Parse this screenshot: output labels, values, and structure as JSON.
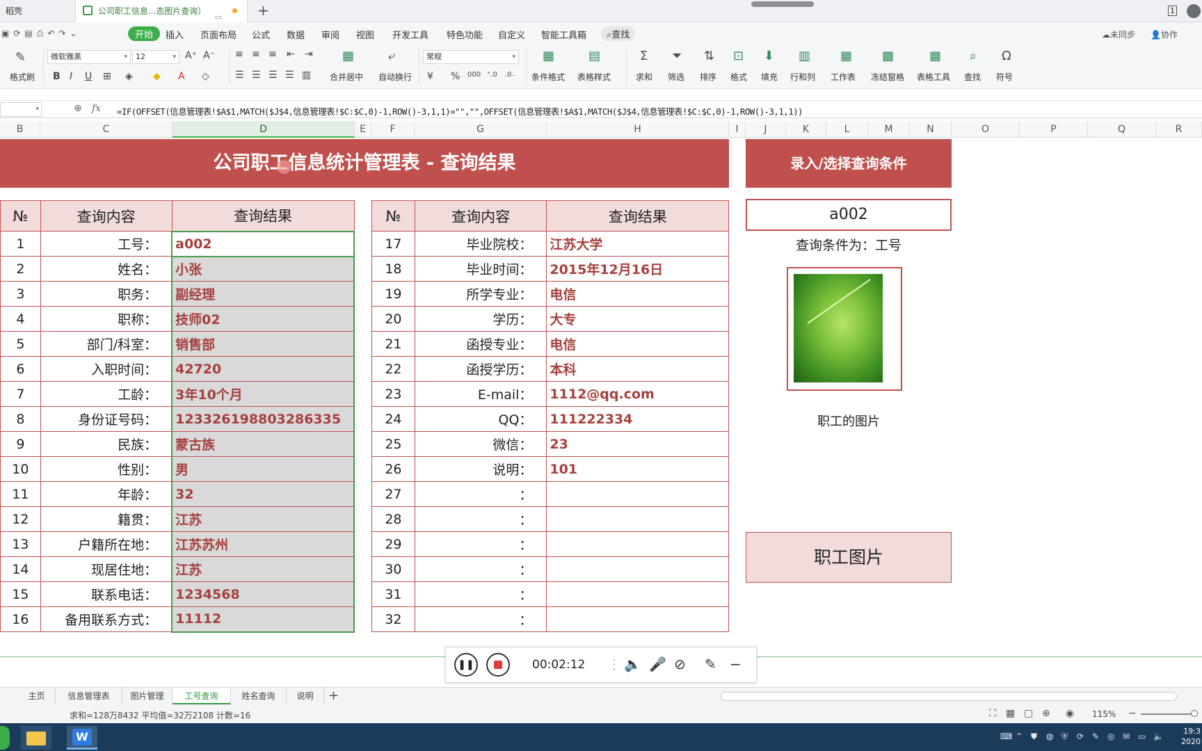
{
  "window": {
    "tabs": [
      {
        "label": "稻壳"
      },
      {
        "label": "公司职工信息...态图片查询）"
      }
    ],
    "win_badge": "1"
  },
  "menu": {
    "items": [
      "开始",
      "插入",
      "页面布局",
      "公式",
      "数据",
      "审阅",
      "视图",
      "开发工具",
      "特色功能",
      "自定义",
      "智能工具箱"
    ],
    "find": "查找",
    "sync": "未同步",
    "collab": "协作"
  },
  "ribbon": {
    "format_painter": "格式刷",
    "font_name": "微软雅黑",
    "font_size": "12",
    "merge_center": "合并居中",
    "wrap_text": "自动换行",
    "number_format": "常规",
    "buttons": [
      "条件格式",
      "表格样式",
      "求和",
      "筛选",
      "排序",
      "格式",
      "填充",
      "行和列",
      "工作表",
      "冻结窗格",
      "表格工具",
      "查找",
      "符号"
    ]
  },
  "formula_bar": {
    "formula": "=IF(OFFSET(信息管理表!$A$1,MATCH($J$4,信息管理表!$C:$C,0)-1,ROW()-3,1,1)=\"\",\"\",OFFSET(信息管理表!$A$1,MATCH($J$4,信息管理表!$C:$C,0)-1,ROW()-3,1,1))"
  },
  "columns": [
    "B",
    "C",
    "D",
    "E",
    "F",
    "G",
    "H",
    "I",
    "J",
    "K",
    "L",
    "M",
    "N",
    "O",
    "P",
    "Q",
    "R"
  ],
  "sheet": {
    "main_title": "公司职工信息统计管理表 - 查询结果",
    "query_title": "录入/选择查询条件",
    "headers": {
      "no": "№",
      "content": "查询内容",
      "result": "查询结果"
    },
    "left_rows": [
      {
        "no": "1",
        "label": "工号：",
        "value": "a002"
      },
      {
        "no": "2",
        "label": "姓名：",
        "value": "小张"
      },
      {
        "no": "3",
        "label": "职务：",
        "value": "副经理"
      },
      {
        "no": "4",
        "label": "职称：",
        "value": "技师02"
      },
      {
        "no": "5",
        "label": "部门/科室：",
        "value": "销售部"
      },
      {
        "no": "6",
        "label": "入职时间：",
        "value": "42720"
      },
      {
        "no": "7",
        "label": "工龄：",
        "value": "3年10个月"
      },
      {
        "no": "8",
        "label": "身份证号码：",
        "value": "123326198803286335"
      },
      {
        "no": "9",
        "label": "民族：",
        "value": "蒙古族"
      },
      {
        "no": "10",
        "label": "性别：",
        "value": "男"
      },
      {
        "no": "11",
        "label": "年龄：",
        "value": "32"
      },
      {
        "no": "12",
        "label": "籍贯：",
        "value": "江苏"
      },
      {
        "no": "13",
        "label": "户籍所在地：",
        "value": "江苏苏州"
      },
      {
        "no": "14",
        "label": "现居住地：",
        "value": "江苏"
      },
      {
        "no": "15",
        "label": "联系电话：",
        "value": "1234568"
      },
      {
        "no": "16",
        "label": "备用联系方式：",
        "value": "11112"
      }
    ],
    "right_rows": [
      {
        "no": "17",
        "label": "毕业院校：",
        "value": "江苏大学"
      },
      {
        "no": "18",
        "label": "毕业时间：",
        "value": "2015年12月16日"
      },
      {
        "no": "19",
        "label": "所学专业：",
        "value": "电信"
      },
      {
        "no": "20",
        "label": "学历：",
        "value": "大专"
      },
      {
        "no": "21",
        "label": "函授专业：",
        "value": "电信"
      },
      {
        "no": "22",
        "label": "函授学历：",
        "value": "本科"
      },
      {
        "no": "23",
        "label": "E-mail：",
        "value": "1112@qq.com"
      },
      {
        "no": "24",
        "label": "QQ：",
        "value": "111222334"
      },
      {
        "no": "25",
        "label": "微信：",
        "value": "23"
      },
      {
        "no": "26",
        "label": "说明：",
        "value": "101"
      },
      {
        "no": "27",
        "label": "：",
        "value": ""
      },
      {
        "no": "28",
        "label": "：",
        "value": ""
      },
      {
        "no": "29",
        "label": "：",
        "value": ""
      },
      {
        "no": "30",
        "label": "：",
        "value": ""
      },
      {
        "no": "31",
        "label": "：",
        "value": ""
      },
      {
        "no": "32",
        "label": "：",
        "value": ""
      }
    ],
    "query_value": "a002",
    "query_condition": "查询条件为：工号",
    "photo_caption": "职工的图片",
    "photo_box_label": "职工图片"
  },
  "recorder": {
    "time": "00:02:12"
  },
  "sheet_tabs": [
    "主页",
    "信息管理表",
    "图片管理",
    "工号查询",
    "姓名查询",
    "说明"
  ],
  "active_sheet": "工号查询",
  "status": {
    "summary": "求和=128万8432  平均值=32万2108  计数=16",
    "zoom": "115%"
  },
  "taskbar": {
    "clock_time": "19:3",
    "clock_date": "2020"
  }
}
